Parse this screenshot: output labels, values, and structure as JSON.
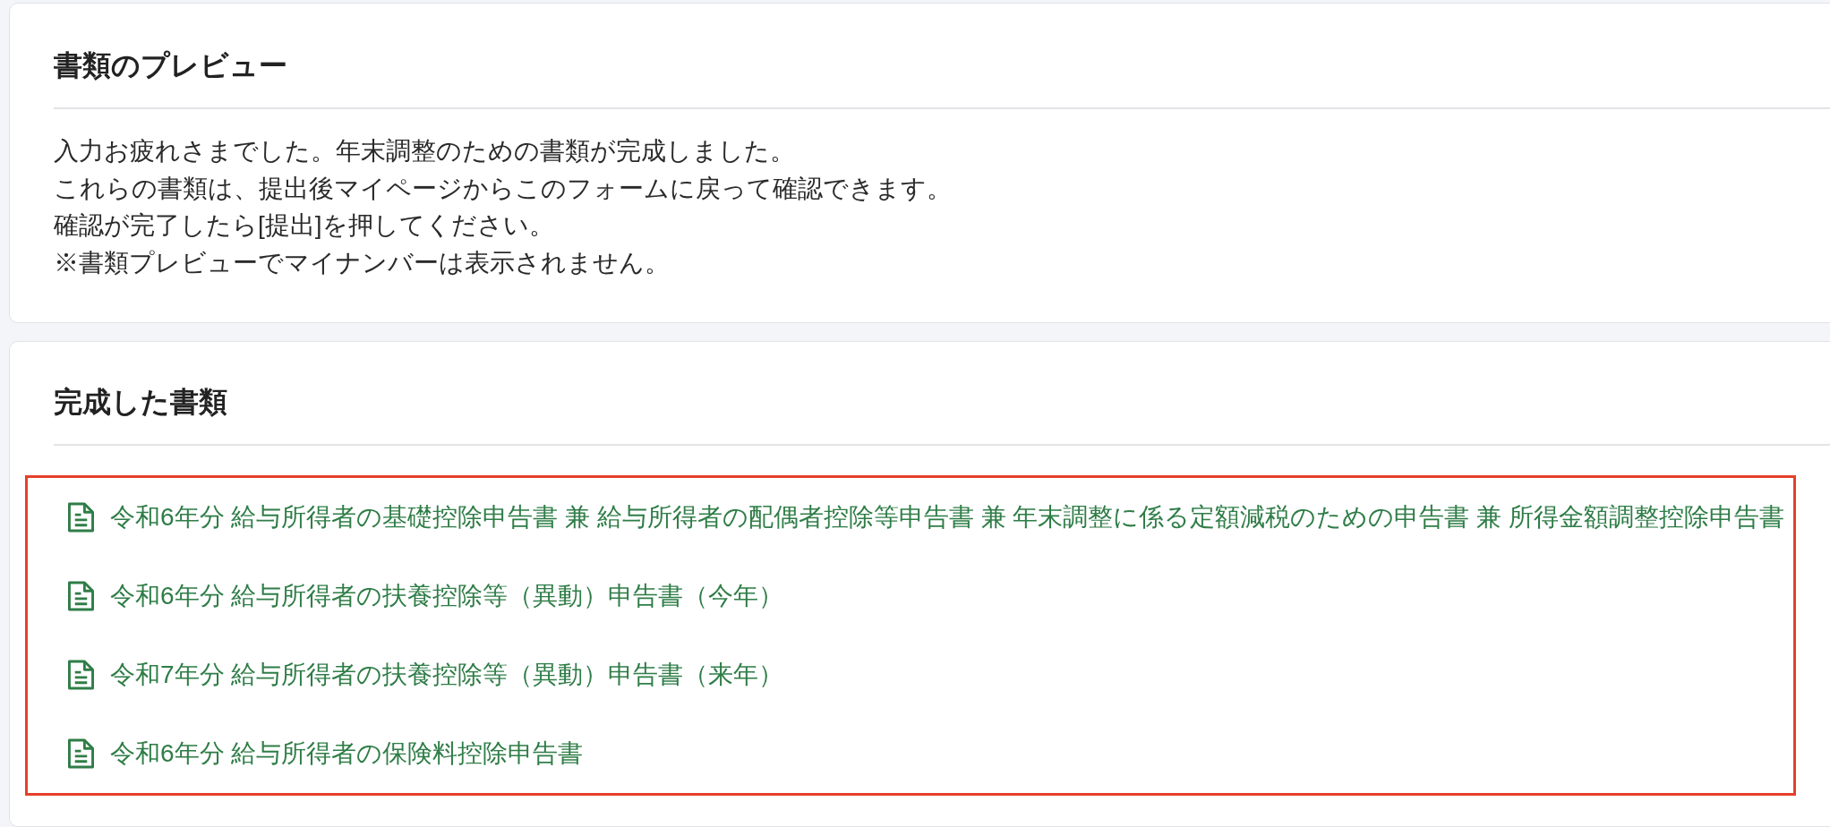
{
  "preview": {
    "title": "書類のプレビュー",
    "message_lines": [
      "入力お疲れさまでした。年末調整のための書類が完成しました。",
      "これらの書類は、提出後マイページからこのフォームに戻って確認できます。",
      "確認が完了したら[提出]を押してください。",
      "※書類プレビューでマイナンバーは表示されません。"
    ]
  },
  "completed": {
    "title": "完成した書類",
    "highlighted": true,
    "documents": [
      "令和6年分 給与所得者の基礎控除申告書 兼 給与所得者の配偶者控除等申告書 兼 年末調整に係る定額減税のための申告書 兼 所得金額調整控除申告書",
      "令和6年分 給与所得者の扶養控除等（異動）申告書（今年）",
      "令和7年分 給与所得者の扶養控除等（異動）申告書（来年）",
      "令和6年分 給与所得者の保険料控除申告書"
    ]
  }
}
